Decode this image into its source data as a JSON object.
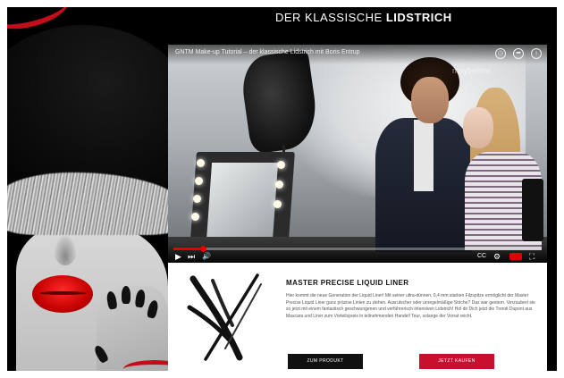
{
  "colors": {
    "background": "#000000",
    "accent_red": "#c8102e",
    "button_dark": "#111111",
    "progress_red": "#e00000"
  },
  "header": {
    "title_light": "DER KLASSISCHE",
    "title_bold": "LIDSTRICH"
  },
  "video": {
    "title": "GNTM Make-up Tutorial – der klassische Lidstrich mit Boris Entrup",
    "watermark": "maybelline",
    "top_icons": [
      "clock-icon",
      "share-icon",
      "info-icon"
    ],
    "progress": 0.08,
    "controls": {
      "play": "▶",
      "next": "⏭",
      "volume": "🔊",
      "cc": "CC",
      "settings": "⚙",
      "fullscreen": "⛶"
    }
  },
  "product": {
    "title": "MASTER PRECISE LIQUID LINER",
    "description": "Hier kommt die neue Generation der Liquid Liner! Mit seiner ultra-dünnen, 0,4 mm starken Filzspitze ermöglicht der Master Precise Liquid Liner ganz präzise Linien zu ziehen. Ausrutscher oder unregelmäßige Striche? Das war gestern. Verzaubert sie so jetzt mit einem fantastisch geschwungenen und verführerisch intensiven Lidstrich! Hol dir Dich jetzt die Trendi Dupont aus Mascara und Liner zum Vorteilspreis in teilnehmenden Handel! Teur, solange der Vorrat reicht.",
    "buttons": {
      "to_product": "ZUM PRODUKT",
      "buy_now": "JETZT KAUFEN"
    }
  }
}
